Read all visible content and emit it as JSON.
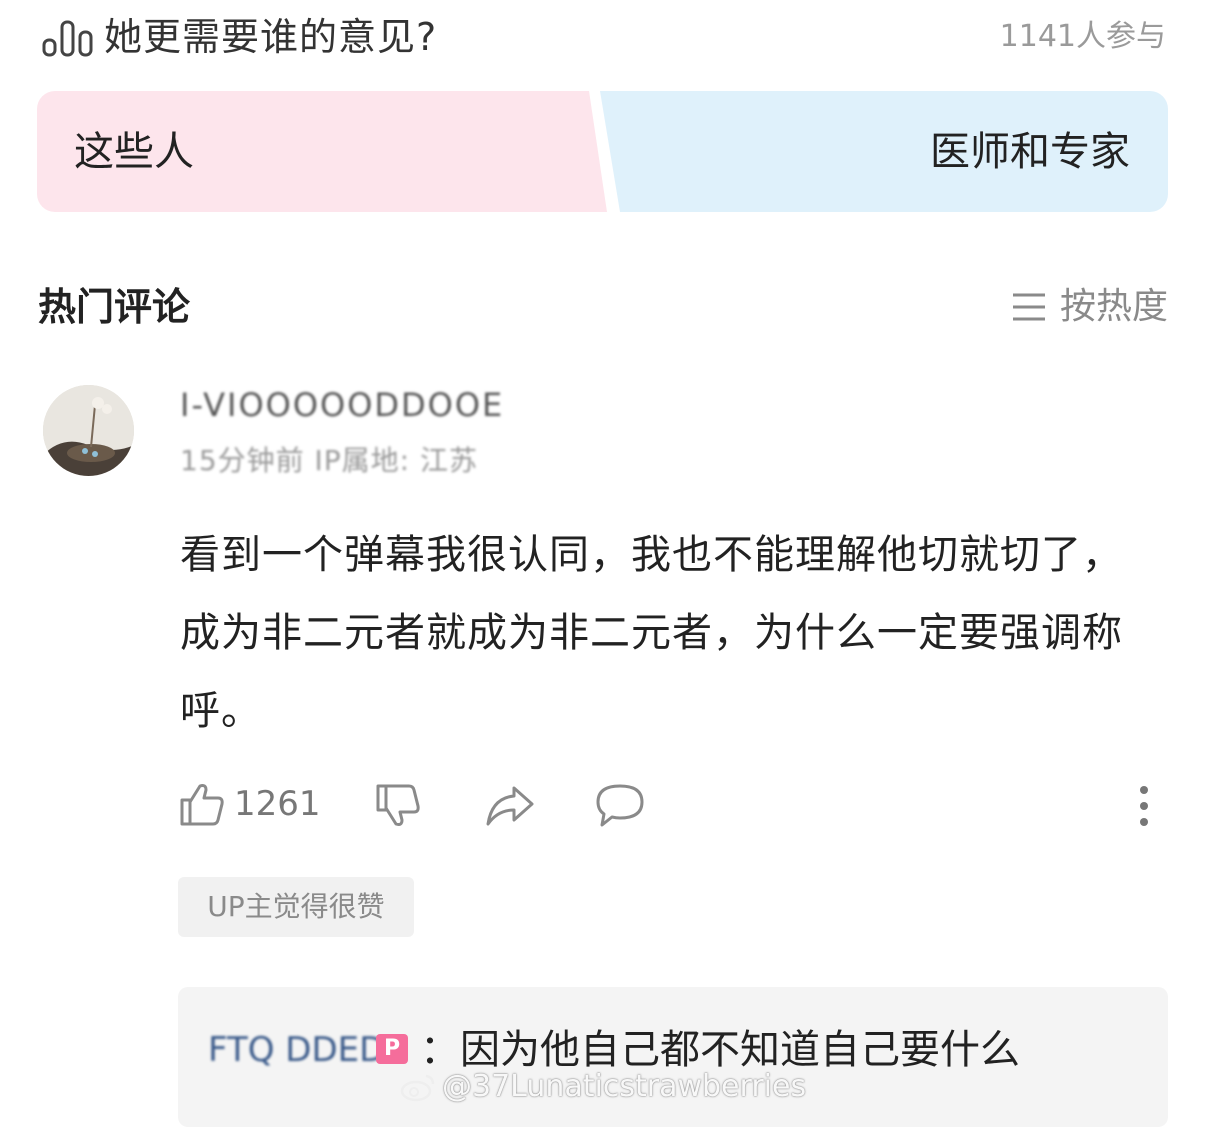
{
  "poll": {
    "title": "她更需要谁的意见?",
    "participants": "1141人参与",
    "option_left": "这些人",
    "option_right": "医师和专家"
  },
  "comments_section": {
    "title": "热门评论",
    "sort_label": "按热度"
  },
  "comment": {
    "username": "I-VIOOOOODDOOE",
    "meta": "15分钟前 IP属地: 江苏",
    "text": "看到一个弹幕我很认同，我也不能理解他切就切了，成为非二元者就成为非二元者，为什么一定要强调称呼。",
    "like_count": "1261",
    "up_badge": "UP主觉得很赞"
  },
  "reply": {
    "username": "FTQ DDED",
    "badge": "P",
    "text": "：因为他自己都不知道自己要什么"
  },
  "watermark": "@37Lunaticstrawberries",
  "colors": {
    "option_left_bg": "#fde5ec",
    "option_right_bg": "#dff1fb",
    "reply_badge": "#f56d9b"
  },
  "icons": [
    "poll-bars-icon",
    "sort-lines-icon",
    "thumbs-up-icon",
    "thumbs-down-icon",
    "share-icon",
    "reply-icon",
    "more-icon",
    "weibo-icon"
  ]
}
